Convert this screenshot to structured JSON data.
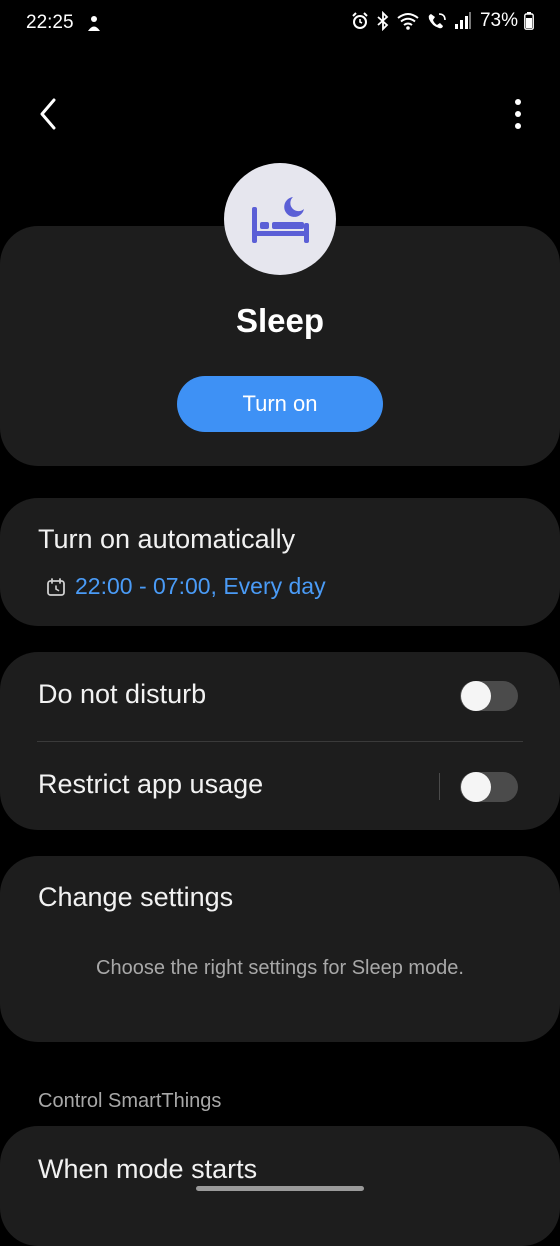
{
  "status_bar": {
    "time": "22:25",
    "battery": "73%"
  },
  "mode": {
    "title": "Sleep",
    "icon": "bed-moon-icon",
    "primary_button": "Turn on"
  },
  "auto": {
    "title": "Turn on automatically",
    "schedule": "22:00 - 07:00, Every day"
  },
  "toggles": [
    {
      "label": "Do not disturb",
      "enabled": false
    },
    {
      "label": "Restrict app usage",
      "enabled": false
    }
  ],
  "settings": {
    "title": "Change settings",
    "description": "Choose the right settings for Sleep mode."
  },
  "section": {
    "header": "Control SmartThings"
  },
  "mode_start": {
    "label": "When mode starts"
  },
  "colors": {
    "accent": "#3e91f5",
    "link": "#4a9bf6",
    "card": "#1d1d1d",
    "background": "#000000",
    "icon_fill": "#5b5fd6"
  }
}
